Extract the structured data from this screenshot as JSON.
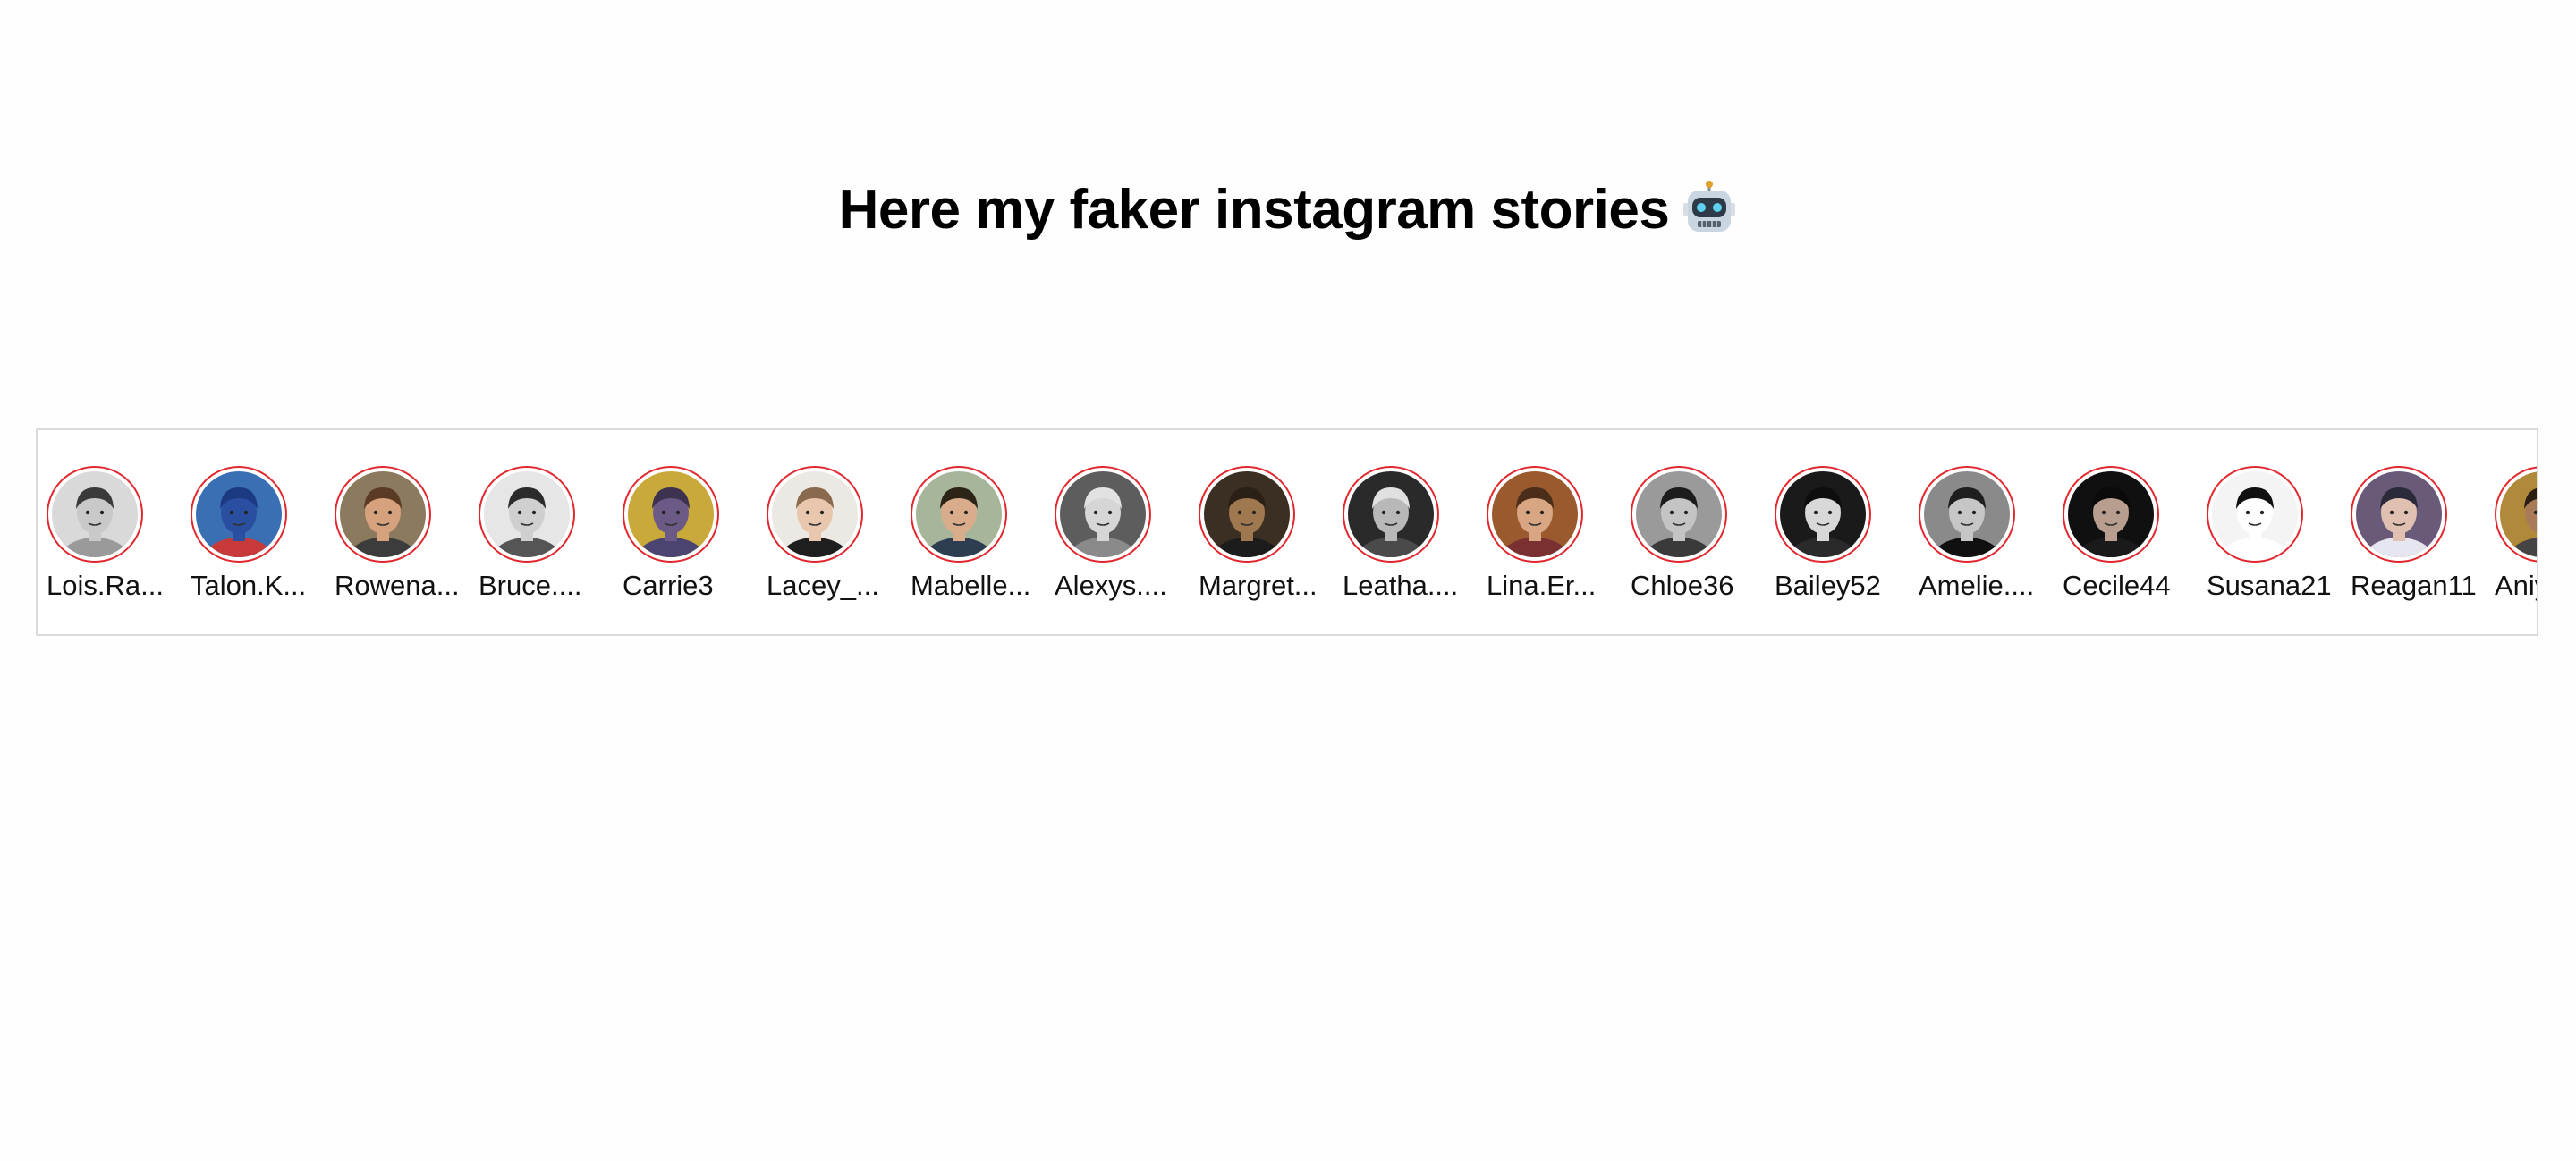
{
  "page": {
    "title": "Here my faker instagram stories"
  },
  "title_icon": "robot-face-icon",
  "stories": [
    {
      "username": "Lois.Ra...",
      "bg": "#d9d9d9",
      "skin": "#c9c9c9",
      "hair": "#3a3a3a",
      "shirt": "#9a9a9a"
    },
    {
      "username": "Talon.K...",
      "bg": "#3b6fb4",
      "skin": "#2a4fa0",
      "hair": "#1b3a82",
      "shirt": "#c83a3a"
    },
    {
      "username": "Rowena...",
      "bg": "#8c7a5e",
      "skin": "#d6a27e",
      "hair": "#5a3a22",
      "shirt": "#3c3c3c"
    },
    {
      "username": "Bruce....",
      "bg": "#e6e6e6",
      "skin": "#cfcfcf",
      "hair": "#2b2b2b",
      "shirt": "#555555"
    },
    {
      "username": "Carrie3",
      "bg": "#c9a93a",
      "skin": "#6b5a86",
      "hair": "#3d3250",
      "shirt": "#4b4370"
    },
    {
      "username": "Lacey_...",
      "bg": "#ece8e4",
      "skin": "#e8c7ae",
      "hair": "#8a6a4e",
      "shirt": "#1e1e1e"
    },
    {
      "username": "Mabelle...",
      "bg": "#a7b59a",
      "skin": "#d9ad8c",
      "hair": "#2d2418",
      "shirt": "#2e3e52"
    },
    {
      "username": "Alexys....",
      "bg": "#5d5d5d",
      "skin": "#d6d6d6",
      "hair": "#e2e2e2",
      "shirt": "#8a8a8a"
    },
    {
      "username": "Margret...",
      "bg": "#3a2f22",
      "skin": "#a07850",
      "hair": "#2a2016",
      "shirt": "#1c1c1c"
    },
    {
      "username": "Leatha....",
      "bg": "#2a2a2a",
      "skin": "#b8b8b8",
      "hair": "#e0e0e0",
      "shirt": "#4a4a4a"
    },
    {
      "username": "Lina.Er...",
      "bg": "#9a5a2e",
      "skin": "#d8a682",
      "hair": "#4a2e1a",
      "shirt": "#7a3030"
    },
    {
      "username": "Chloe36",
      "bg": "#9a9a9a",
      "skin": "#c4c4c4",
      "hair": "#1c1c1c",
      "shirt": "#3a3a3a"
    },
    {
      "username": "Bailey52",
      "bg": "#1a1a1a",
      "skin": "#d8d8d8",
      "hair": "#0e0e0e",
      "shirt": "#2a2a2a"
    },
    {
      "username": "Amelie....",
      "bg": "#8a8a8a",
      "skin": "#c6c6c6",
      "hair": "#1e1e1e",
      "shirt": "#101010"
    },
    {
      "username": "Cecile44",
      "bg": "#101010",
      "skin": "#b89e8e",
      "hair": "#0a0a0a",
      "shirt": "#1a1a1a"
    },
    {
      "username": "Susana21",
      "bg": "#f4f4f4",
      "skin": "#ffffff",
      "hair": "#111111",
      "shirt": "#ffffff"
    },
    {
      "username": "Reagan11",
      "bg": "#6a5a7a",
      "skin": "#e0c0b0",
      "hair": "#2a2a3a",
      "shirt": "#e6e6f0"
    },
    {
      "username": "Aniya...",
      "bg": "#b08a3a",
      "skin": "#a87a58",
      "hair": "#2a1e14",
      "shirt": "#444444"
    }
  ],
  "colors": {
    "ring": "#e0282e",
    "border": "#dbdbdb"
  }
}
